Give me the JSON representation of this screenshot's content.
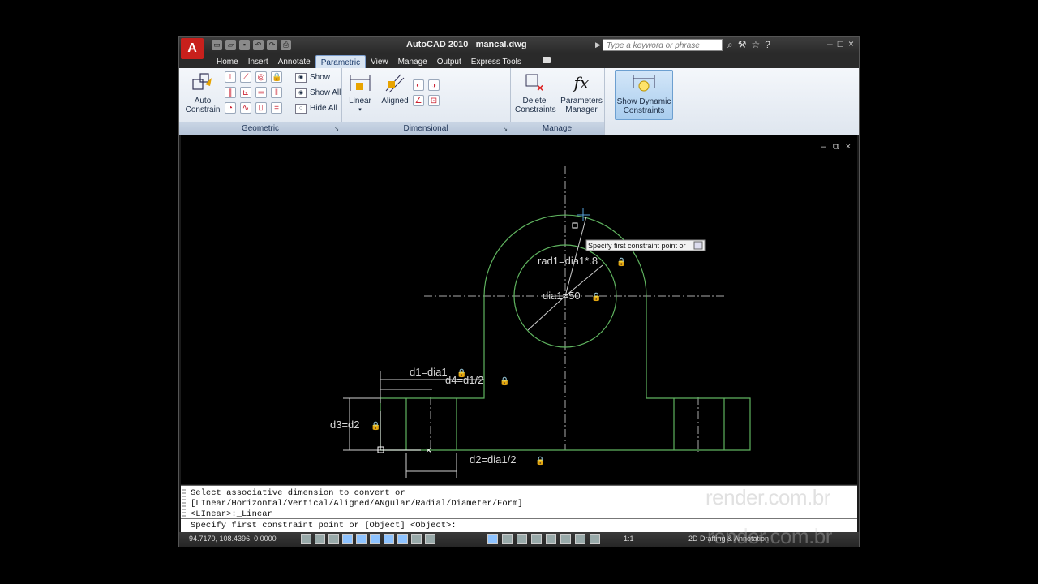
{
  "window": {
    "title": "AutoCAD 2010",
    "filename": "mancal.dwg",
    "search_placeholder": "Type a keyword or phrase",
    "app_logo": "A"
  },
  "tabs": [
    {
      "label": "Home"
    },
    {
      "label": "Insert"
    },
    {
      "label": "Annotate"
    },
    {
      "label": "Parametric",
      "active": true
    },
    {
      "label": "View"
    },
    {
      "label": "Manage"
    },
    {
      "label": "Output"
    },
    {
      "label": "Express Tools"
    }
  ],
  "ribbon": {
    "geometric": {
      "title": "Geometric",
      "auto_constrain_l1": "Auto",
      "auto_constrain_l2": "Constrain",
      "show": "Show",
      "show_all": "Show All",
      "hide_all": "Hide All"
    },
    "dimensional": {
      "title": "Dimensional",
      "linear": "Linear",
      "aligned": "Aligned",
      "show_dynamic_l1": "Show Dynamic",
      "show_dynamic_l2": "Constraints"
    },
    "manage": {
      "title": "Manage",
      "delete_l1": "Delete",
      "delete_l2": "Constraints",
      "params_l1": "Parameters",
      "params_l2": "Manager",
      "fx": "fx"
    }
  },
  "drawing": {
    "tooltip": "Specify first constraint point or",
    "labels": {
      "rad1": "rad1=dia1*.8",
      "dia1": "dia1=50",
      "d1": "d1=dia1",
      "d4": "d4=d1/2",
      "d3": "d3=d2",
      "d2": "d2=dia1/2"
    }
  },
  "command": {
    "line1": "Select associative dimension to convert or",
    "line2": "[LInear/Horizontal/Vertical/Aligned/ANgular/Radial/Diameter/Form]",
    "line3": "<LInear>:_Linear",
    "line4": "Specify first constraint point or [Object] <Object>:"
  },
  "status": {
    "coords": "94.7170, 108.4396, 0.0000",
    "scale": "1:1",
    "workspace": "2D Drafting & Annotation"
  },
  "watermark": "render.com.br",
  "colors": {
    "geometry": "#5fb35f",
    "dimension": "#d9d9d9",
    "ribbon_active": "#a9cdee"
  }
}
